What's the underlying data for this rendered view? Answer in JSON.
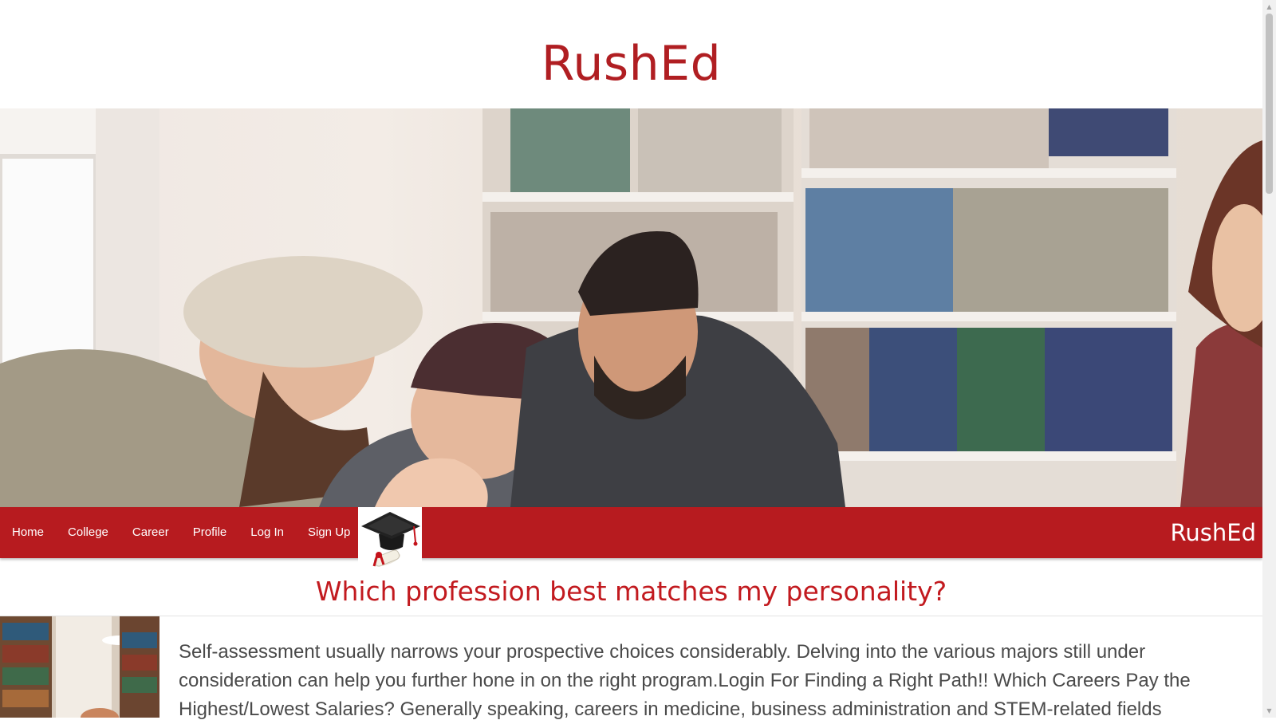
{
  "header": {
    "title": "RushEd"
  },
  "hero": {
    "image": "students-laughing-library-photo"
  },
  "nav": {
    "items": [
      {
        "label": "Home"
      },
      {
        "label": "College"
      },
      {
        "label": "Career"
      },
      {
        "label": "Profile"
      },
      {
        "label": "Log In"
      },
      {
        "label": "Sign Up"
      }
    ],
    "logo_icon": "graduation-cap-diploma-icon",
    "brand": "RushEd"
  },
  "main": {
    "heading": "Which profession best matches my personality?",
    "thumbnail": "library-bookshelves-photo",
    "body": "Self-assessment usually narrows your prospective choices considerably. Delving into the various majors still under consideration can help you further hone in on the right program.Login For Finding a Right Path!! Which Careers Pay the Highest/Lowest Salaries? Generally speaking, careers in medicine, business administration and STEM-related fields"
  },
  "colors": {
    "brand_red": "#b71b1f",
    "title_red": "#b01e22",
    "heading_red": "#c21a1f",
    "body_text": "#4a4a4a"
  }
}
